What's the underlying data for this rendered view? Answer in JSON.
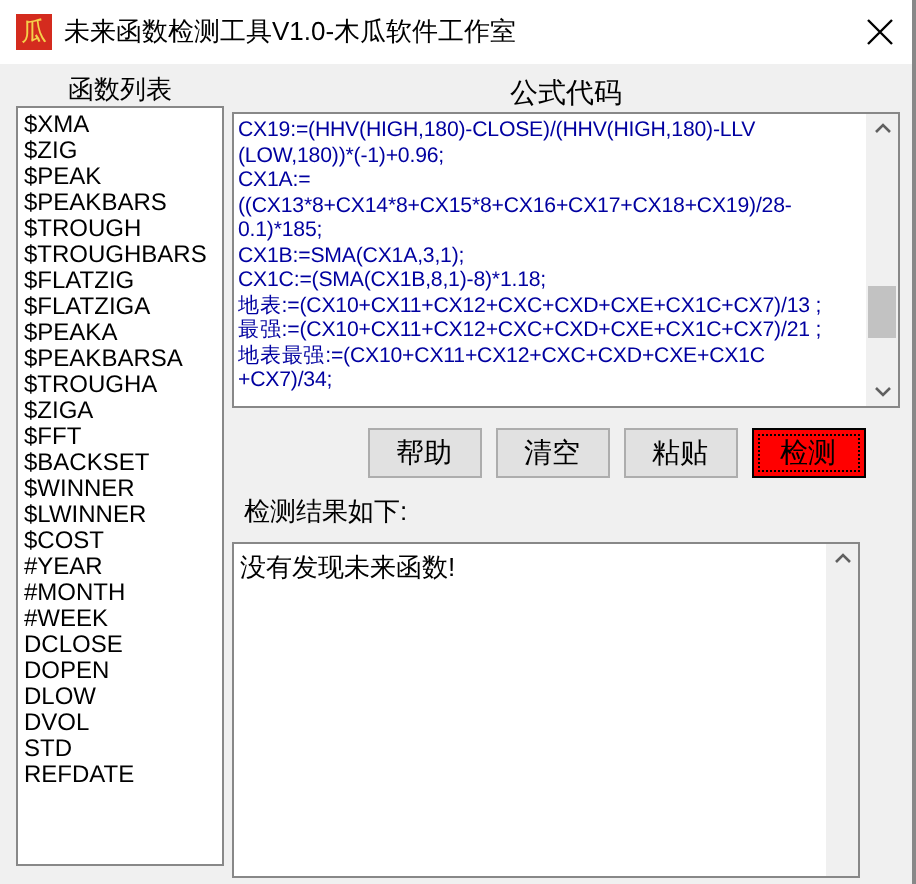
{
  "window": {
    "title": "未来函数检测工具V1.0-木瓜软件工作室",
    "logo": "瓜"
  },
  "function_list": {
    "header": "函数列表",
    "items": [
      "$XMA",
      "$ZIG",
      "$PEAK",
      "$PEAKBARS",
      "$TROUGH",
      "$TROUGHBARS",
      "$FLATZIG",
      "$FLATZIGA",
      "$PEAKA",
      "$PEAKBARSA",
      "$TROUGHA",
      "$ZIGA",
      "$FFT",
      "$BACKSET",
      "$WINNER",
      "$LWINNER",
      "$COST",
      "#YEAR",
      "#MONTH",
      "#WEEK",
      "DCLOSE",
      "DOPEN",
      "DLOW",
      "DVOL",
      "STD",
      "REFDATE"
    ]
  },
  "code": {
    "header": "公式代码",
    "lines": [
      "CX19:=(HHV(HIGH,180)-CLOSE)/(HHV(HIGH,180)-LLV",
      "(LOW,180))*(-1)+0.96;",
      "CX1A:=",
      "((CX13*8+CX14*8+CX15*8+CX16+CX17+CX18+CX19)/28-",
      "0.1)*185;",
      "CX1B:=SMA(CX1A,3,1);",
      "CX1C:=(SMA(CX1B,8,1)-8)*1.18;",
      "地表:=(CX10+CX11+CX12+CXC+CXD+CXE+CX1C+CX7)/13 ;",
      "最强:=(CX10+CX11+CX12+CXC+CXD+CXE+CX1C+CX7)/21 ;",
      "地表最强:=(CX10+CX11+CX12+CXC+CXD+CXE+CX1C",
      "+CX7)/34;"
    ]
  },
  "buttons": [
    {
      "label": "帮助",
      "kind": "normal"
    },
    {
      "label": "清空",
      "kind": "normal"
    },
    {
      "label": "粘贴",
      "kind": "normal"
    },
    {
      "label": "检测",
      "kind": "primary"
    }
  ],
  "result": {
    "label": "检测结果如下:",
    "text": "没有发现未来函数!"
  }
}
